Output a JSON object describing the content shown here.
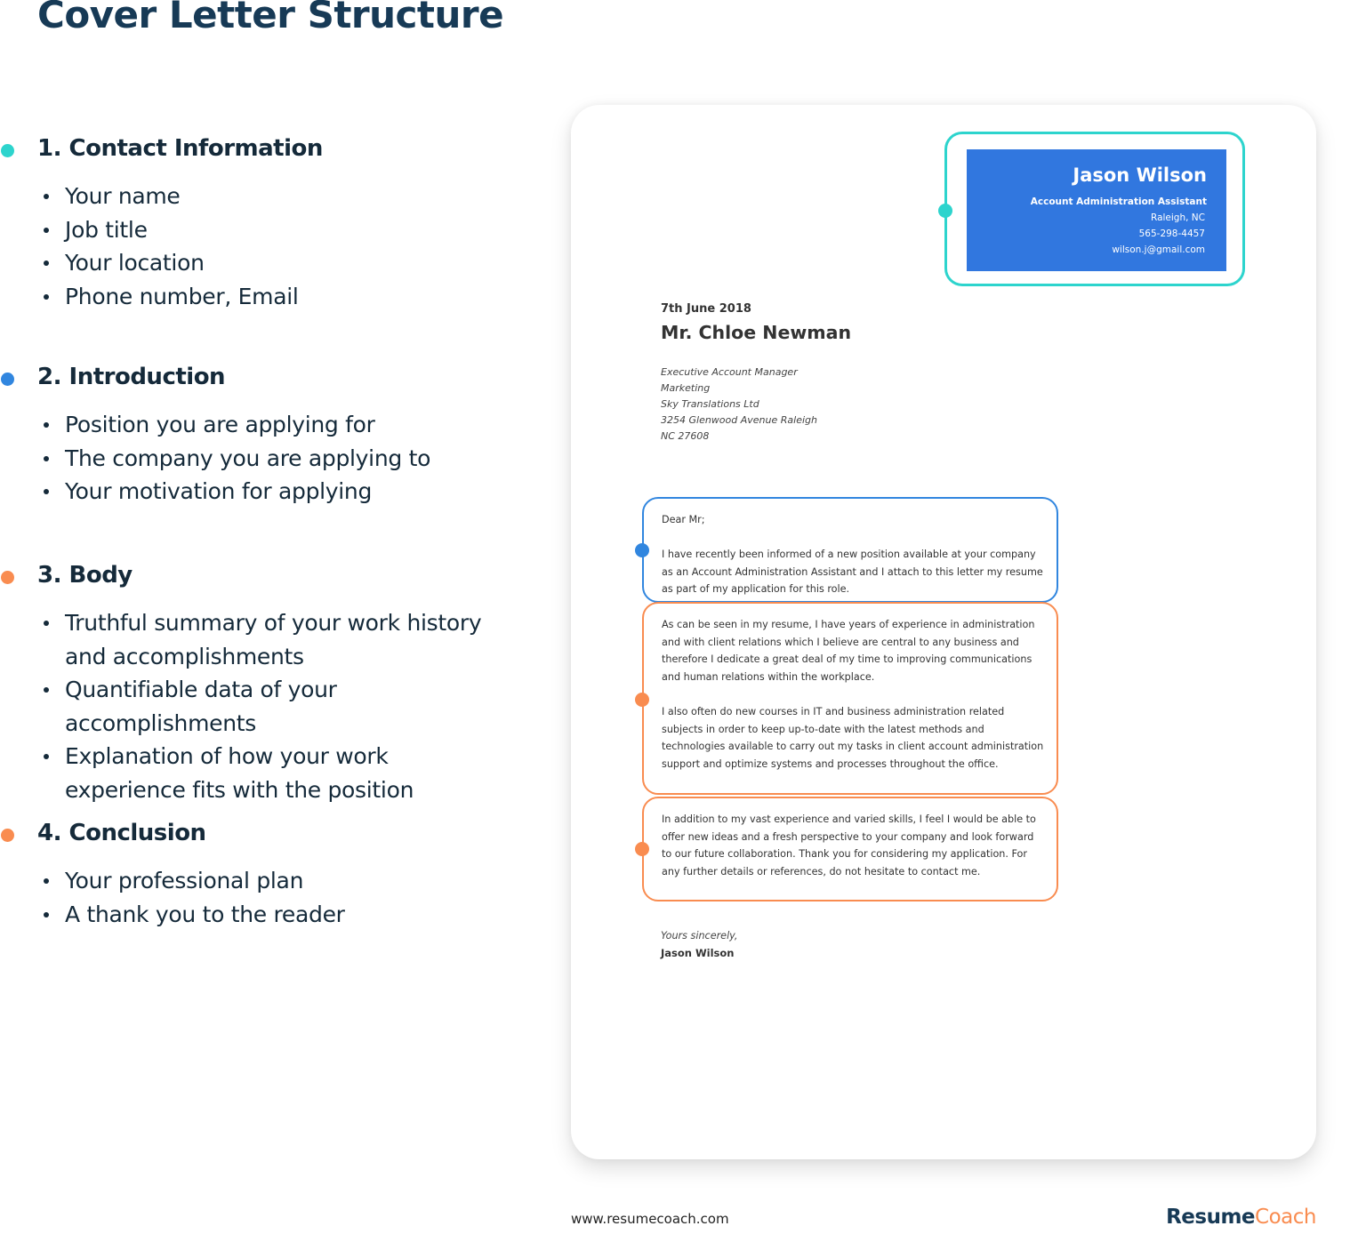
{
  "page": {
    "title": "Cover Letter Structure"
  },
  "colors": {
    "teal": "#2dd4cd",
    "blue": "#3186df",
    "orange": "#f98c50",
    "card_blue": "#3177df",
    "title_navy": "#173a56",
    "brand_navy": "#173a56",
    "brand_orange": "#f98c50"
  },
  "sections": [
    {
      "heading": "1. Contact Information",
      "dot_color": "#2dd4cd",
      "items": [
        "Your name",
        "Job title",
        "Your location",
        "Phone number, Email"
      ]
    },
    {
      "heading": "2. Introduction",
      "dot_color": "#3186df",
      "items": [
        "Position you are applying for",
        "The company you are applying to",
        "Your motivation for applying"
      ]
    },
    {
      "heading": "3. Body",
      "dot_color": "#f98c50",
      "items": [
        "Truthful summary of your work history and accomplishments",
        "Quantifiable data of your accomplishments",
        "Explanation of how your work experience fits with the position"
      ]
    },
    {
      "heading": "4. Conclusion",
      "dot_color": "#f98c50",
      "items": [
        "Your professional plan",
        "A thank you to the reader"
      ]
    }
  ],
  "letter": {
    "contact": {
      "name": "Jason Wilson",
      "job_title": "Account Administration Assistant",
      "location": "Raleigh, NC",
      "phone": "565-298-4457",
      "email": "wilson.j@gmail.com"
    },
    "date": "7th June 2018",
    "recipient": "Mr. Chloe Newman",
    "address": [
      "Executive Account Manager",
      "Marketing",
      "Sky Translations Ltd",
      "3254 Glenwood Avenue Raleigh",
      "NC 27608"
    ],
    "intro": {
      "salutation": "Dear Mr;",
      "text": "I have recently been informed of a new position available at your company as an Account Administration Assistant and I attach to this letter my resume as part of my application for this role."
    },
    "body": [
      "As can be seen in my resume, I have years of experience in administration and with client relations which I believe are central to any business and therefore I dedicate a great deal of my time to improving communications and human relations within the workplace.",
      "I also often do new courses in IT and business administration related subjects in order to keep up-to-date with the latest methods and technologies available to carry out my tasks in client account administration support and optimize systems and processes throughout the office."
    ],
    "conclusion": "In addition to my vast experience and varied skills, I feel I would be able to offer new ideas and a fresh perspective to your company and look forward to our future collaboration. Thank you for considering my application. For any further details or references, do not hesitate to contact me.",
    "closing": "Yours sincerely,",
    "signature": "Jason Wilson"
  },
  "footer": {
    "url": "www.resumecoach.com",
    "brand_part1": "Resume",
    "brand_part2": "Coach"
  }
}
